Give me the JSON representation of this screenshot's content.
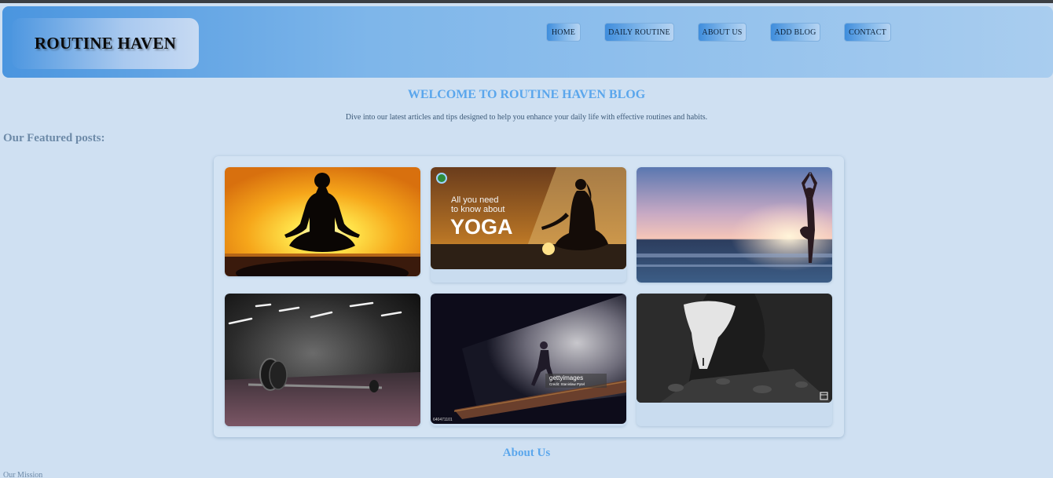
{
  "header": {
    "logo": "ROUTINE HAVEN",
    "nav": [
      "HOME",
      "DAILY ROUTINE",
      "ABOUT US",
      "ADD BLOG",
      "CONTACT"
    ]
  },
  "hero": {
    "title": "WELCOME TO ROUTINE HAVEN BLOG",
    "intro": "Dive into our latest articles and tips designed to help you enhance your daily life with effective routines and habits."
  },
  "featured": {
    "heading": "Our Featured posts:",
    "posts": [
      {
        "image": "meditation-sunset-silhouette"
      },
      {
        "image": "yoga-beach-promo",
        "overlay_line1": "All you need",
        "overlay_line2": "to know about",
        "overlay_big": "YOGA"
      },
      {
        "image": "tree-pose-ocean-sunset"
      },
      {
        "image": "barbell-dark-gym"
      },
      {
        "image": "runner-tunnel-stock",
        "watermark": "gettyimages",
        "credit": "Credit: Stanislaw Pytel",
        "stock_id": "640471101"
      },
      {
        "image": "cave-hiker-monochrome"
      }
    ]
  },
  "about": {
    "title": "About Us",
    "mission": "Our Mission"
  },
  "colors": {
    "page_bg": "#cfe0f2",
    "accent": "#5aa6ec",
    "header_start": "#4a95df",
    "header_end": "#a9cdef"
  }
}
